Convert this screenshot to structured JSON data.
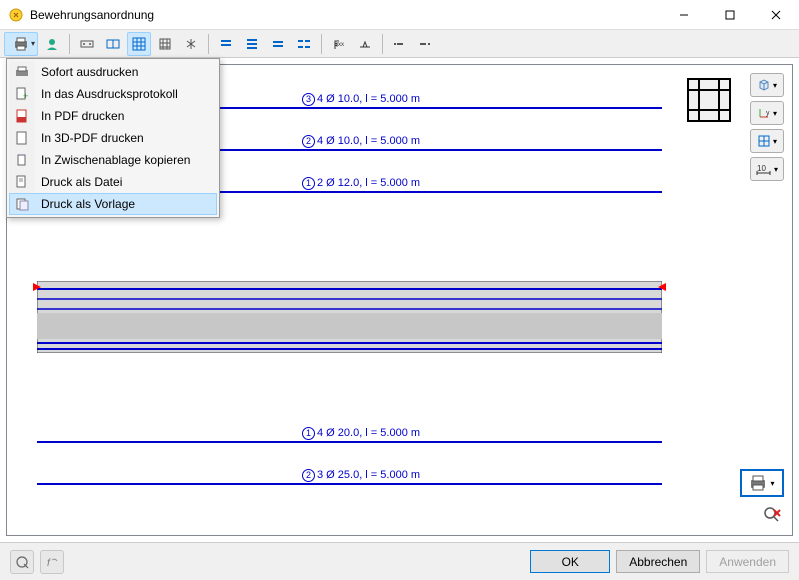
{
  "title": "Bewehrungsanordnung",
  "menu": {
    "items": [
      {
        "label": "Sofort ausdrucken",
        "icon": "print"
      },
      {
        "label": "In das Ausdrucksprotokoll",
        "icon": "doc-plus"
      },
      {
        "label": "In PDF drucken",
        "icon": "pdf"
      },
      {
        "label": "In 3D-PDF drucken",
        "icon": "doc"
      },
      {
        "label": "In Zwischenablage kopieren",
        "icon": "copy"
      },
      {
        "label": "Druck als Datei",
        "icon": "file"
      },
      {
        "label": "Druck als Vorlage",
        "icon": "template",
        "hovered": true
      }
    ]
  },
  "bars": [
    {
      "num": "3",
      "text": "4 Ø 10.0, l = 5.000 m"
    },
    {
      "num": "2",
      "text": "4 Ø 10.0, l = 5.000 m"
    },
    {
      "num": "1",
      "text": "2 Ø 12.0, l = 5.000 m"
    },
    {
      "num": "1",
      "text": "4 Ø 20.0, l = 5.000 m"
    },
    {
      "num": "2",
      "text": "3 Ø 25.0, l = 5.000 m"
    }
  ],
  "buttons": {
    "ok": "OK",
    "cancel": "Abbrechen",
    "apply": "Anwenden"
  },
  "right_panel": {
    "items": [
      "cube",
      "axes",
      "grid",
      "dim"
    ]
  }
}
